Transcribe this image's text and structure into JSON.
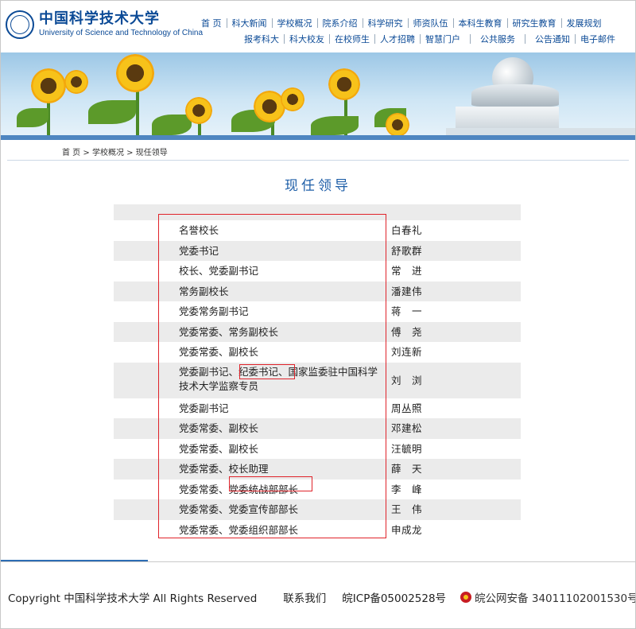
{
  "logo": {
    "cn": "中国科学技术大学",
    "en": "University of Science and Technology of China"
  },
  "nav": {
    "row1": [
      "首 页",
      "科大新闻",
      "学校概况",
      "院系介绍",
      "科学研究",
      "师资队伍",
      "本科生教育",
      "研究生教育",
      "发展规划"
    ],
    "row2": [
      "报考科大",
      "科大校友",
      "在校师生",
      "人才招聘",
      "智慧门户",
      "公共服务",
      "公告通知",
      "电子邮件"
    ]
  },
  "breadcrumb": {
    "home": "首 页",
    "sep": ">",
    "section": "学校概况",
    "current": "现任领导"
  },
  "page_title": "现任领导",
  "leaders": [
    {
      "position": "名誉校长",
      "name": "白春礼"
    },
    {
      "position": "党委书记",
      "name": "舒歌群"
    },
    {
      "position": "校长、党委副书记",
      "name": "常　进"
    },
    {
      "position": "常务副校长",
      "name": "潘建伟"
    },
    {
      "position": "党委常务副书记",
      "name": "蒋　一"
    },
    {
      "position": "党委常委、常务副校长",
      "name": "傅　尧"
    },
    {
      "position": "党委常委、副校长",
      "name": "刘连新"
    },
    {
      "position": "党委副书记、纪委书记、国家监委驻中国科学技术大学监察专员",
      "name": "刘　浏"
    },
    {
      "position": "党委副书记",
      "name": "周丛照"
    },
    {
      "position": "党委常委、副校长",
      "name": "邓建松"
    },
    {
      "position": "党委常委、副校长",
      "name": "汪毓明"
    },
    {
      "position": "党委常委、校长助理",
      "name": "薛　天"
    },
    {
      "position": "党委常委、党委统战部部长",
      "name": "李　峰"
    },
    {
      "position": "党委常委、党委宣传部部长",
      "name": "王　伟"
    },
    {
      "position": "党委常委、党委组织部部长",
      "name": "申成龙"
    }
  ],
  "footer": {
    "copyright": "Copyright 中国科学技术大学 All Rights Reserved",
    "contact": "联系我们",
    "icp": "皖ICP备05002528号",
    "police": "皖公网安备 34011102001530号"
  },
  "colors": {
    "brand_blue": "#0b4a96",
    "title_blue": "#1f5fa8",
    "highlight_red": "#e0232a",
    "row_grey": "#ebebeb"
  },
  "icons": {
    "logo": "university-seal-icon",
    "police": "police-badge-icon"
  }
}
